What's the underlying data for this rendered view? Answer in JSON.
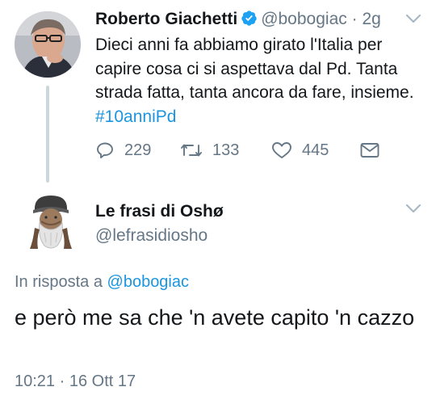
{
  "original_tweet": {
    "author_name": "Roberto Giachetti",
    "handle": "@bobogiac",
    "separator": "·",
    "time_ago": "2g",
    "text": "Dieci anni fa abbiamo girato l'Italia per capire cosa ci si aspettava dal Pd. Tanta strada fatta, tanta ancora da fare, insieme.",
    "hashtag": "#10anniPd",
    "replies_count": "229",
    "retweets_count": "133",
    "likes_count": "445",
    "verified": true
  },
  "reply_tweet": {
    "author_name": "Le frasi di Oshø",
    "handle": "@lefrasidiosho",
    "reply_prefix": "In risposta a",
    "reply_mention": "@bobogiac",
    "text": "e però me sa che 'n avete capito 'n cazzo",
    "time": "10:21",
    "separator": "·",
    "date": "16 Ott 17"
  },
  "colors": {
    "text": "#14171a",
    "secondary": "#657786",
    "link": "#1b95e0",
    "thread_line": "#ccd6dd",
    "verified_badge": "#1da1f2"
  }
}
